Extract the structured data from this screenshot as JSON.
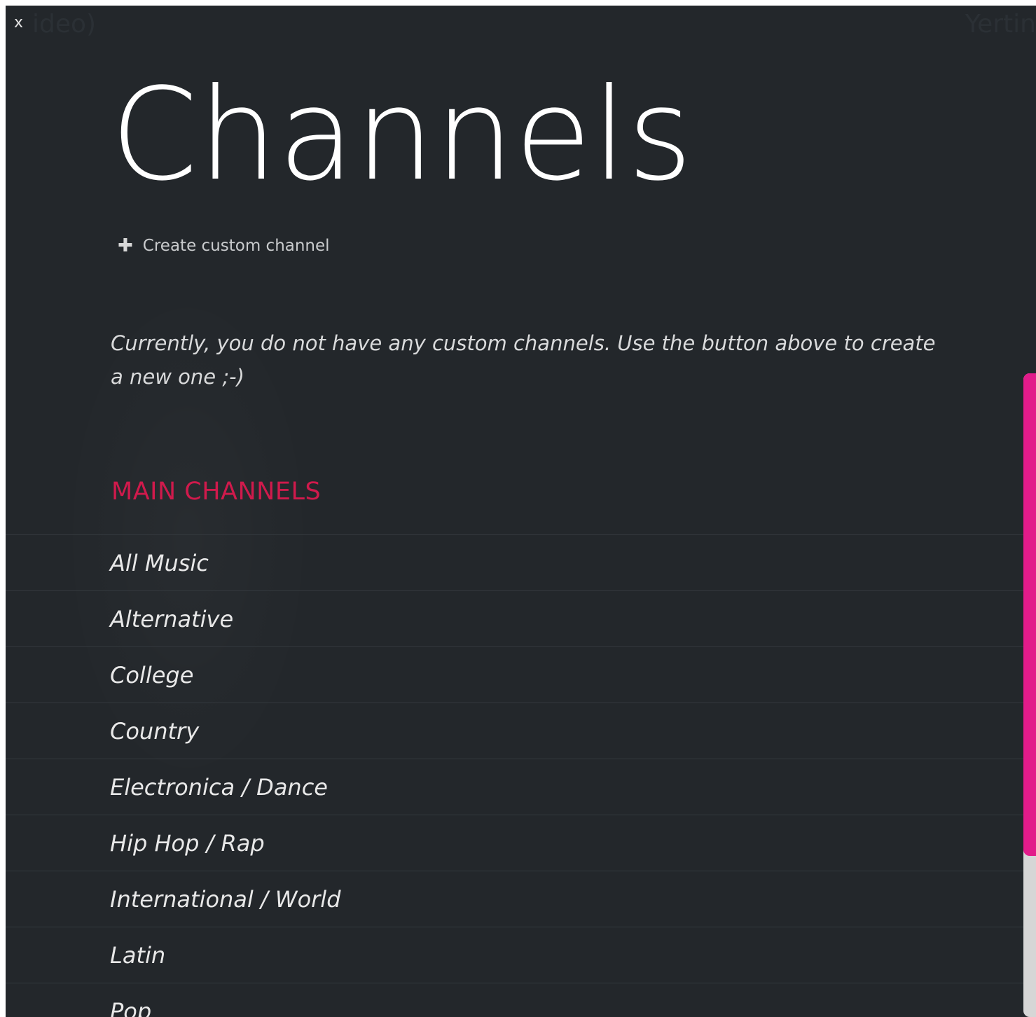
{
  "close_label": "x",
  "background": {
    "left_ghost_text": "ideo)",
    "right_ghost_text": "Yertin"
  },
  "page": {
    "title": "Channels",
    "create_button": {
      "icon": "plus-icon",
      "label": "Create custom channel"
    },
    "empty_message": "Currently, you do not have any custom channels. Use the button above to create a new one ;-)"
  },
  "main_channels": {
    "heading": "MAIN CHANNELS",
    "items": [
      "All Music",
      "Alternative",
      "College",
      "Country",
      "Electronica / Dance",
      "Hip Hop / Rap",
      "International / World",
      "Latin",
      "Pop"
    ]
  },
  "colors": {
    "background": "#23272b",
    "accent_heading": "#d01a4c",
    "scrollbar_thumb": "#e21b8a",
    "scrollbar_track": "#d6d6d6"
  },
  "scroll": {
    "thumb_fraction": 0.75
  }
}
